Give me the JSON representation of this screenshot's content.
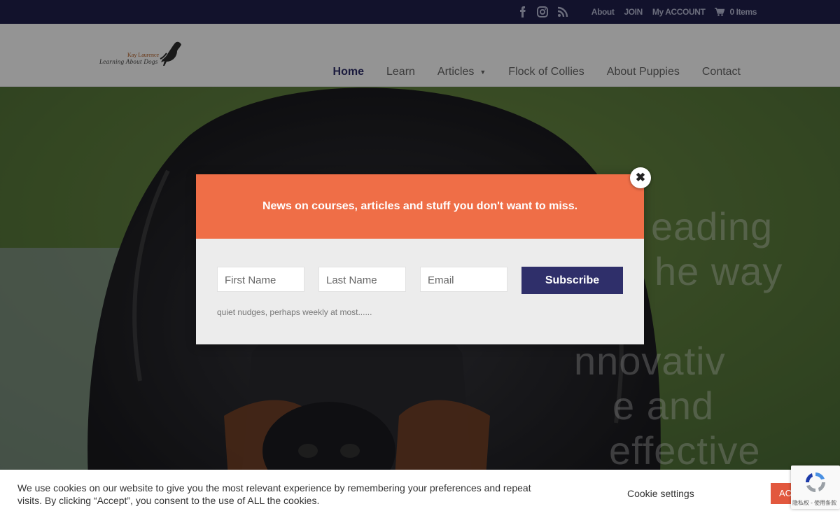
{
  "topbar": {
    "social": [
      "facebook-icon",
      "instagram-icon",
      "rss-icon"
    ],
    "links": [
      "About",
      "JOIN",
      "My ACCOUNT"
    ],
    "cart_label": "0 Items"
  },
  "logo": {
    "line1": "Kay Laurence",
    "line2": "Learning About Dogs"
  },
  "nav": {
    "items": [
      "Home",
      "Learn",
      "Articles",
      "Flock of Collies",
      "About Puppies",
      "Contact"
    ],
    "active": "Home"
  },
  "hero": {
    "lines": [
      "eading",
      "he way",
      "nnovativ",
      "e and",
      "effective"
    ]
  },
  "popup": {
    "heading": "News on courses, articles and stuff you don't want to miss.",
    "first_name_placeholder": "First Name",
    "last_name_placeholder": "Last Name",
    "email_placeholder": "Email",
    "subscribe_label": "Subscribe",
    "note": "quiet nudges, perhaps weekly at most......"
  },
  "cookie": {
    "text": "We use cookies on our website to give you the most relevant experience by remembering your preferences and repeat visits. By clicking “Accept”, you consent to the use of ALL the cookies.",
    "settings_label": "Cookie settings",
    "accept_label": "ACCEPT"
  },
  "recaptcha": {
    "label": "隐私权 - 使用条款"
  },
  "colors": {
    "topbar": "#1f1f4d",
    "accent": "#2f2f6a",
    "popup_header": "#ef6e47",
    "accept": "#e2583e"
  }
}
